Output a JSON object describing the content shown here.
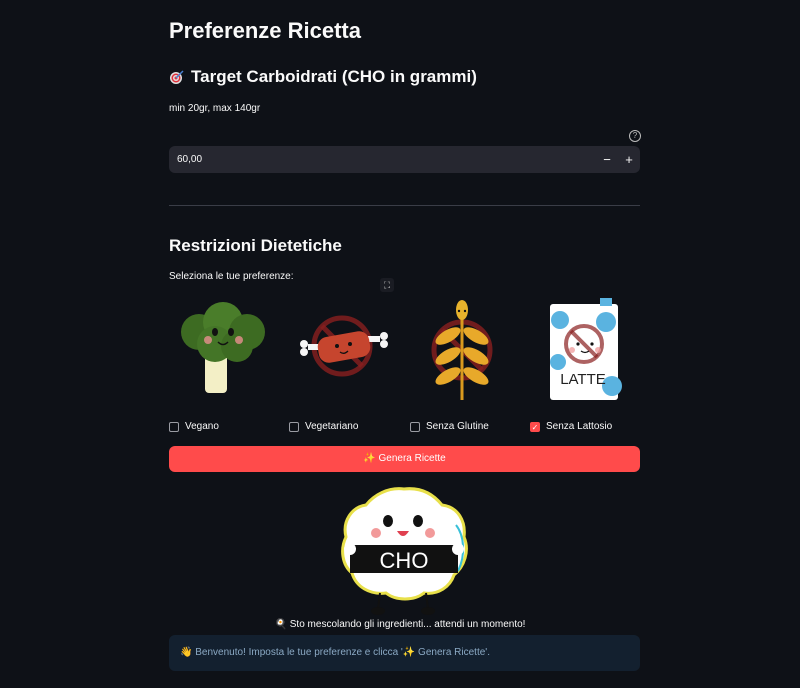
{
  "page": {
    "title": "Preferenze Ricetta"
  },
  "target": {
    "icon": "target-dart-icon",
    "heading": "Target Carboidrati (CHO in grammi)",
    "caption": "min 20gr, max 140gr",
    "help_icon": "?",
    "value": "60,00",
    "minus_label": "−",
    "plus_label": "+"
  },
  "restrictions": {
    "heading": "Restrizioni Dietetiche",
    "select_label": "Seleziona le tue preferenze:",
    "expand_icon": "⛶",
    "options": [
      {
        "label": "Vegano",
        "checked": false,
        "image": "broccoli-image"
      },
      {
        "label": "Vegetariano",
        "checked": false,
        "image": "no-meat-image"
      },
      {
        "label": "Senza Glutine",
        "checked": false,
        "image": "no-wheat-image"
      },
      {
        "label": "Senza Lattosio",
        "checked": true,
        "image": "no-milk-image"
      }
    ],
    "milk_carton_text": "LATTE"
  },
  "generate_button": {
    "label": "✨ Genera Ricette"
  },
  "mascot": {
    "text": "CHO"
  },
  "status": {
    "text": "🍳 Sto mescolando gli ingredienti... attendi un momento!"
  },
  "info": {
    "text": "👋 Benvenuto! Imposta le tue preferenze e clicca '✨ Genera Ricette'."
  },
  "colors": {
    "accent": "#ff4b4b",
    "background": "#0e1117",
    "input_bg": "#262730",
    "info_bg": "#172d43"
  }
}
